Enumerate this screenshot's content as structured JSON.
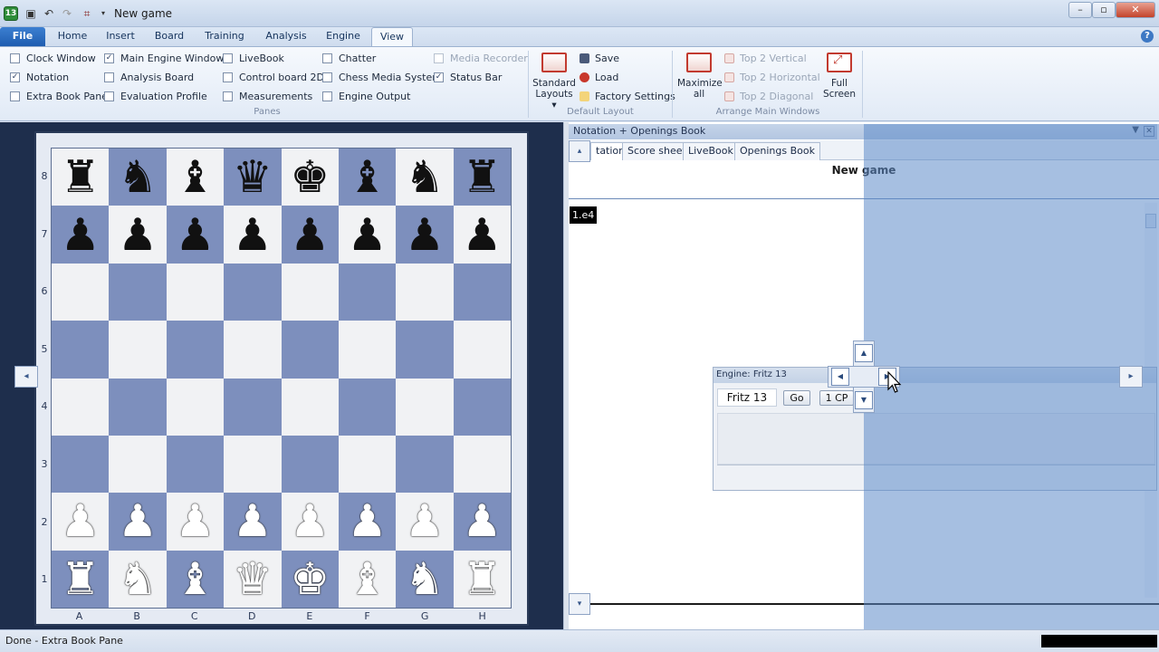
{
  "window": {
    "title": "New game",
    "app_badge": "13"
  },
  "ribbon_tabs": [
    "File",
    "Insert",
    "Board",
    "Training",
    "Analysis",
    "Engine",
    "View"
  ],
  "panes": {
    "col1": [
      {
        "label": "Clock Window",
        "checked": false
      },
      {
        "label": "Notation",
        "checked": true
      },
      {
        "label": "Extra Book Pane",
        "checked": false
      }
    ],
    "col2": [
      {
        "label": "Main Engine Window",
        "checked": true
      },
      {
        "label": "Analysis Board",
        "checked": false
      },
      {
        "label": "Evaluation Profile",
        "checked": false
      }
    ],
    "col3": [
      {
        "label": "LiveBook",
        "checked": false
      },
      {
        "label": "Control board 2D",
        "checked": false
      },
      {
        "label": "Measurements",
        "checked": false
      }
    ],
    "col4": [
      {
        "label": "Chatter",
        "checked": false
      },
      {
        "label": "Chess Media System",
        "checked": false
      },
      {
        "label": "Engine Output",
        "checked": false
      }
    ],
    "col5": [
      {
        "label": "Media Recorder",
        "checked": false,
        "disabled": true
      },
      {
        "label": "Status Bar",
        "checked": true
      }
    ],
    "group_label": "Panes"
  },
  "default_layout": {
    "standard_layouts_line1": "Standard",
    "standard_layouts_line2": "Layouts ▾",
    "save": "Save",
    "load": "Load",
    "factory": "Factory Settings",
    "group_label": "Default Layout"
  },
  "arrange": {
    "maximize_line1": "Maximize",
    "maximize_line2": "all",
    "top2_vertical": "Top 2 Vertical",
    "top2_horizontal": "Top 2 Horizontal",
    "top2_diagonal": "Top 2 Diagonal",
    "full_line1": "Full",
    "full_line2": "Screen",
    "group_label": "Arrange Main Windows"
  },
  "board": {
    "ranks": [
      "8",
      "7",
      "6",
      "5",
      "4",
      "3",
      "2",
      "1"
    ],
    "files": [
      "A",
      "B",
      "C",
      "D",
      "E",
      "F",
      "G",
      "H"
    ],
    "position": [
      [
        "bR",
        "bN",
        "bB",
        "bQ",
        "bK",
        "bB",
        "bN",
        "bR"
      ],
      [
        "bP",
        "bP",
        "bP",
        "bP",
        "bP",
        "bP",
        "bP",
        "bP"
      ],
      [
        "",
        "",
        "",
        "",
        "",
        "",
        "",
        ""
      ],
      [
        "",
        "",
        "",
        "",
        "",
        "",
        "",
        ""
      ],
      [
        "",
        "",
        "",
        "",
        "",
        "",
        "",
        ""
      ],
      [
        "",
        "",
        "",
        "",
        "",
        "",
        "",
        ""
      ],
      [
        "wP",
        "wP",
        "wP",
        "wP",
        "wP",
        "wP",
        "wP",
        "wP"
      ],
      [
        "wR",
        "wN",
        "wB",
        "wQ",
        "wK",
        "wB",
        "wN",
        "wR"
      ]
    ]
  },
  "notation": {
    "header": "Notation + Openings Book",
    "tabs": [
      "tation",
      "Score sheet",
      "LiveBook",
      "Openings Book"
    ],
    "game_title": "New game",
    "moves": [
      "1.e4"
    ]
  },
  "engine": {
    "header": "Engine: Fritz 13",
    "name": "Fritz 13",
    "go": "Go",
    "cpu": "1 CP"
  },
  "status": {
    "text": "Done - Extra Book Pane"
  }
}
